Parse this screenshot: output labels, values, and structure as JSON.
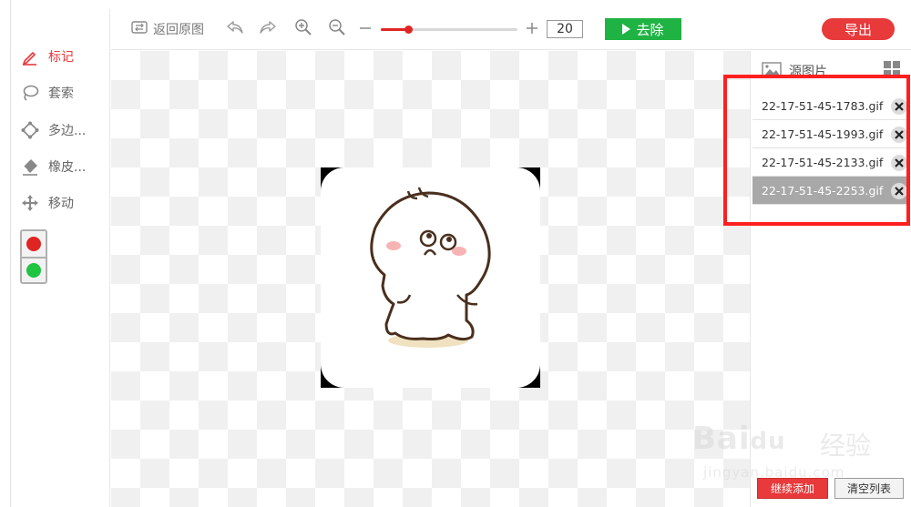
{
  "toolbar": {
    "restore_label": "返回原图",
    "zoom_value": "20",
    "zoom_fraction": 0.2,
    "remove_label": "去除",
    "export_label": "导出"
  },
  "tools": [
    {
      "label": "标记",
      "icon": "pencil-icon",
      "active": true
    },
    {
      "label": "套索",
      "icon": "lasso-icon",
      "active": false
    },
    {
      "label": "多边...",
      "icon": "polygon-icon",
      "active": false
    },
    {
      "label": "橡皮...",
      "icon": "eraser-icon",
      "active": false
    },
    {
      "label": "移动",
      "icon": "move-icon",
      "active": false
    }
  ],
  "colors": {
    "red": "#e02424",
    "green": "#1fc441",
    "accent": "#e8393b",
    "remove": "#1fb344"
  },
  "right_panel": {
    "title": "源图片",
    "files": [
      {
        "name": "22-17-51-45-1783.gif",
        "selected": false
      },
      {
        "name": "22-17-51-45-1993.gif",
        "selected": false
      },
      {
        "name": "22-17-51-45-2133.gif",
        "selected": false
      },
      {
        "name": "22-17-51-45-2253.gif",
        "selected": true
      }
    ],
    "add_label": "继续添加",
    "clear_label": "清空列表"
  },
  "watermark": {
    "main": "Bai",
    "main2": "du",
    "cn": "经验",
    "sub": "jingyan.baidu.com"
  }
}
